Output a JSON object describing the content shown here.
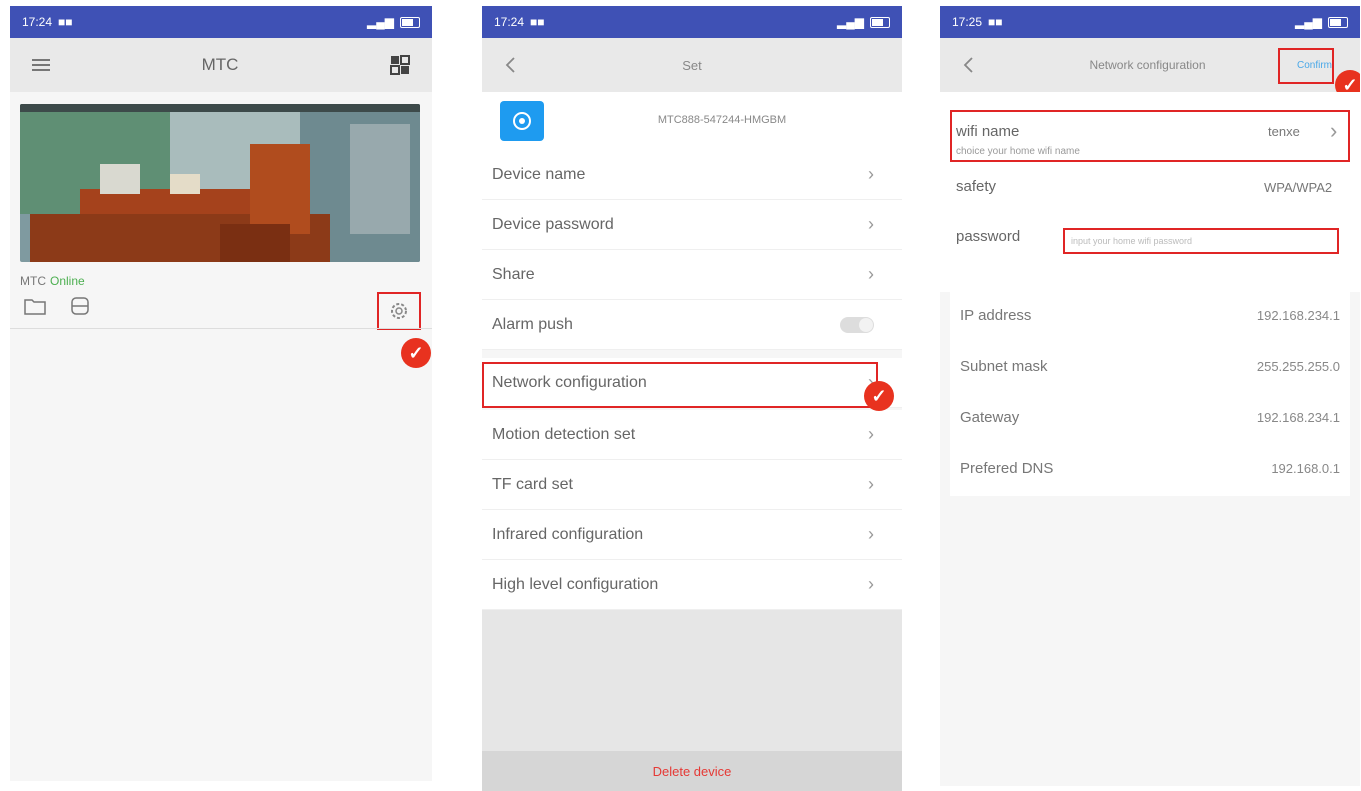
{
  "phone1": {
    "status": {
      "time": "17:24"
    },
    "appbar": {
      "title": "MTC"
    },
    "device": {
      "name": "MTC",
      "state": "Online"
    }
  },
  "phone2": {
    "status": {
      "time": "17:24"
    },
    "appbar": {
      "title": "Set"
    },
    "device_id": "MTC888-547244-HMGBM",
    "rows": [
      {
        "label": "Device name"
      },
      {
        "label": "Device password"
      },
      {
        "label": "Share"
      },
      {
        "label": "Alarm push"
      },
      {
        "label": "Network configuration"
      },
      {
        "label": "Motion detection set"
      },
      {
        "label": "TF card set"
      },
      {
        "label": "Infrared configuration"
      },
      {
        "label": "High level configuration"
      }
    ],
    "delete_label": "Delete device"
  },
  "phone3": {
    "status": {
      "time": "17:25"
    },
    "appbar": {
      "title": "Network configuration",
      "confirm_label": "Confirm"
    },
    "wifi": {
      "label": "wifi name",
      "value": "tenxe",
      "hint": "choice your home wifi name"
    },
    "safety": {
      "label": "safety",
      "value": "WPA/WPA2"
    },
    "password": {
      "label": "password",
      "placeholder": "input your home wifi password"
    },
    "network": [
      {
        "label": "IP address",
        "value": "192.168.234.1"
      },
      {
        "label": "Subnet mask",
        "value": "255.255.255.0"
      },
      {
        "label": "Gateway",
        "value": "192.168.234.1"
      },
      {
        "label": "Prefered DNS",
        "value": "192.168.0.1"
      }
    ]
  },
  "colors": {
    "accent": "#3f51b5",
    "highlight": "#e02525",
    "online": "#4caf50",
    "delete": "#e53935"
  }
}
